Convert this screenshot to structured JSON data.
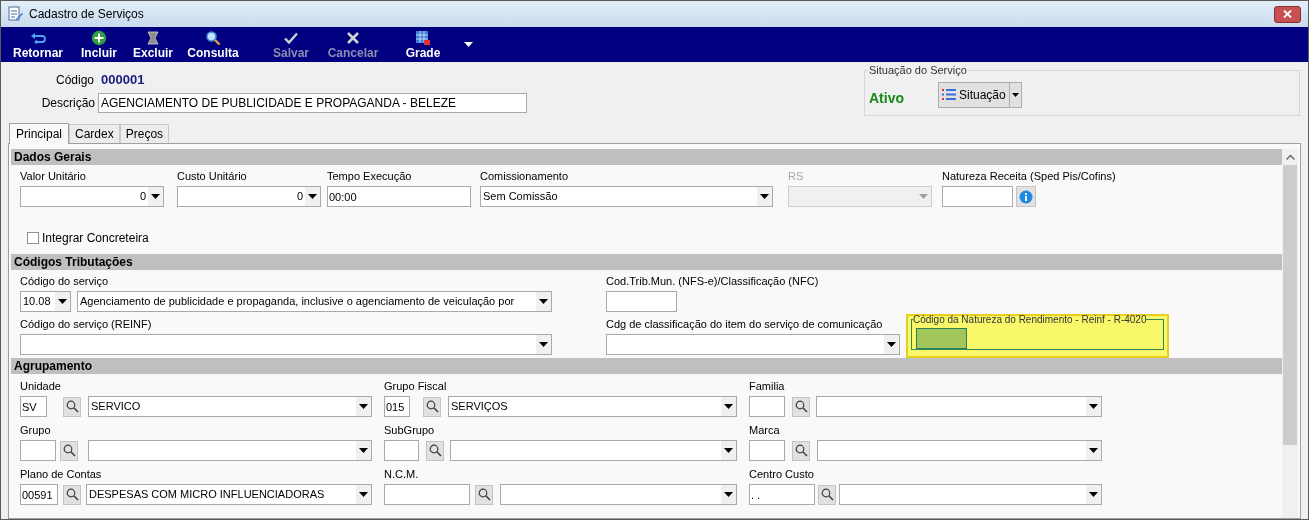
{
  "window": {
    "title": "Cadastro de Serviços"
  },
  "toolbar": [
    {
      "kind": "return",
      "label": "Retornar",
      "disabled": false
    },
    {
      "kind": "add",
      "label": "Incluir",
      "disabled": false
    },
    {
      "kind": "delete",
      "label": "Excluir",
      "disabled": false
    },
    {
      "kind": "search",
      "label": "Consulta",
      "disabled": false
    },
    {
      "kind": "save",
      "label": "Salvar",
      "disabled": true
    },
    {
      "kind": "cancel",
      "label": "Cancelar",
      "disabled": true
    },
    {
      "kind": "grid",
      "label": "Grade",
      "disabled": false
    }
  ],
  "header": {
    "code_label": "Código",
    "code": "000001",
    "description_label": "Descrição",
    "description": "AGENCIAMENTO DE PUBLICIDADE E PROPAGANDA - BELEZE"
  },
  "status_group": {
    "title": "Situação do Serviço",
    "status": "Ativo",
    "button": "Situação"
  },
  "tabs": [
    {
      "label": "Principal",
      "selected": true
    },
    {
      "label": "Cardex",
      "selected": false
    },
    {
      "label": "Preços",
      "selected": false
    }
  ],
  "sections": [
    {
      "title": "Dados Gerais",
      "fields": [
        {
          "kind": "combo",
          "label": "Valor Unitário",
          "value": "0",
          "disabled": false
        },
        {
          "kind": "combo",
          "label": "Custo Unitário",
          "value": "0",
          "disabled": false
        },
        {
          "kind": "text",
          "label": "Tempo Execução",
          "value": "00:00",
          "disabled": false
        },
        {
          "kind": "combo",
          "label": "Comissionamento",
          "value": "Sem Comissão",
          "disabled": false
        },
        {
          "kind": "combo",
          "label": "RS",
          "disabled": true
        },
        {
          "kind": "info",
          "label": "Natureza Receita (Sped Pis/Cofins)",
          "disabled": false
        },
        {
          "kind": "checkbox",
          "label": "Integrar Concreteira",
          "checked": false
        }
      ]
    },
    {
      "title": "Códigos Tributações",
      "fields": [
        {
          "kind": "code_combo",
          "label": "Código do serviço",
          "code": "10.08",
          "value": "Agenciamento de publicidade e propaganda, inclusive o agenciamento de veiculação por"
        },
        {
          "kind": "text",
          "label": "Cod.Trib.Mun. (NFS-e)/Classificação (NFC)"
        },
        {
          "kind": "combo",
          "label": "Código do serviço (REINF)"
        },
        {
          "kind": "combo",
          "label": "Cdg de classificação do item do serviço de comunicação"
        },
        {
          "kind": "highlight_group",
          "label": "Código da Natureza do Rendimento - Reinf - R-4020"
        }
      ]
    },
    {
      "title": "Agrupamento",
      "fields": [
        {
          "kind": "lookup",
          "label": "Unidade",
          "code": "SV",
          "value": "SERVICO"
        },
        {
          "kind": "lookup",
          "label": "Grupo Fiscal",
          "code": "015",
          "value": "SERVIÇOS"
        },
        {
          "kind": "lookup",
          "label": "Familia"
        },
        {
          "kind": "lookup",
          "label": "Grupo"
        },
        {
          "kind": "lookup",
          "label": "SubGrupo"
        },
        {
          "kind": "lookup",
          "label": "Marca"
        },
        {
          "kind": "lookup",
          "label": "Plano de Contas",
          "code": "00591",
          "value": "DESPESAS COM MICRO INFLUENCIADORAS"
        },
        {
          "kind": "lookup",
          "label": "N.C.M."
        },
        {
          "kind": "lookup",
          "label": "Centro Custo",
          "code": ". ."
        }
      ]
    }
  ]
}
